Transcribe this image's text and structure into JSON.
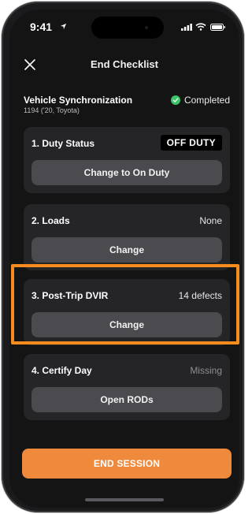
{
  "status_bar": {
    "time": "9:41"
  },
  "header": {
    "title": "End Checklist"
  },
  "sync": {
    "title": "Vehicle Synchronization",
    "subtitle": "1194 ('20, Toyota)",
    "status": "Completed"
  },
  "cards": [
    {
      "title": "1. Duty Status",
      "value": "OFF DUTY",
      "button": "Change to On Duty"
    },
    {
      "title": "2. Loads",
      "value": "None",
      "button": "Change"
    },
    {
      "title": "3. Post-Trip DVIR",
      "value": "14 defects",
      "button": "Change"
    },
    {
      "title": "4. Certify Day",
      "value": "Missing",
      "button": "Open RODs"
    }
  ],
  "footer": {
    "end_session": "END SESSION"
  },
  "colors": {
    "accent": "#ef8a3c",
    "highlight": "#f68c1e",
    "success": "#3cc46a"
  }
}
